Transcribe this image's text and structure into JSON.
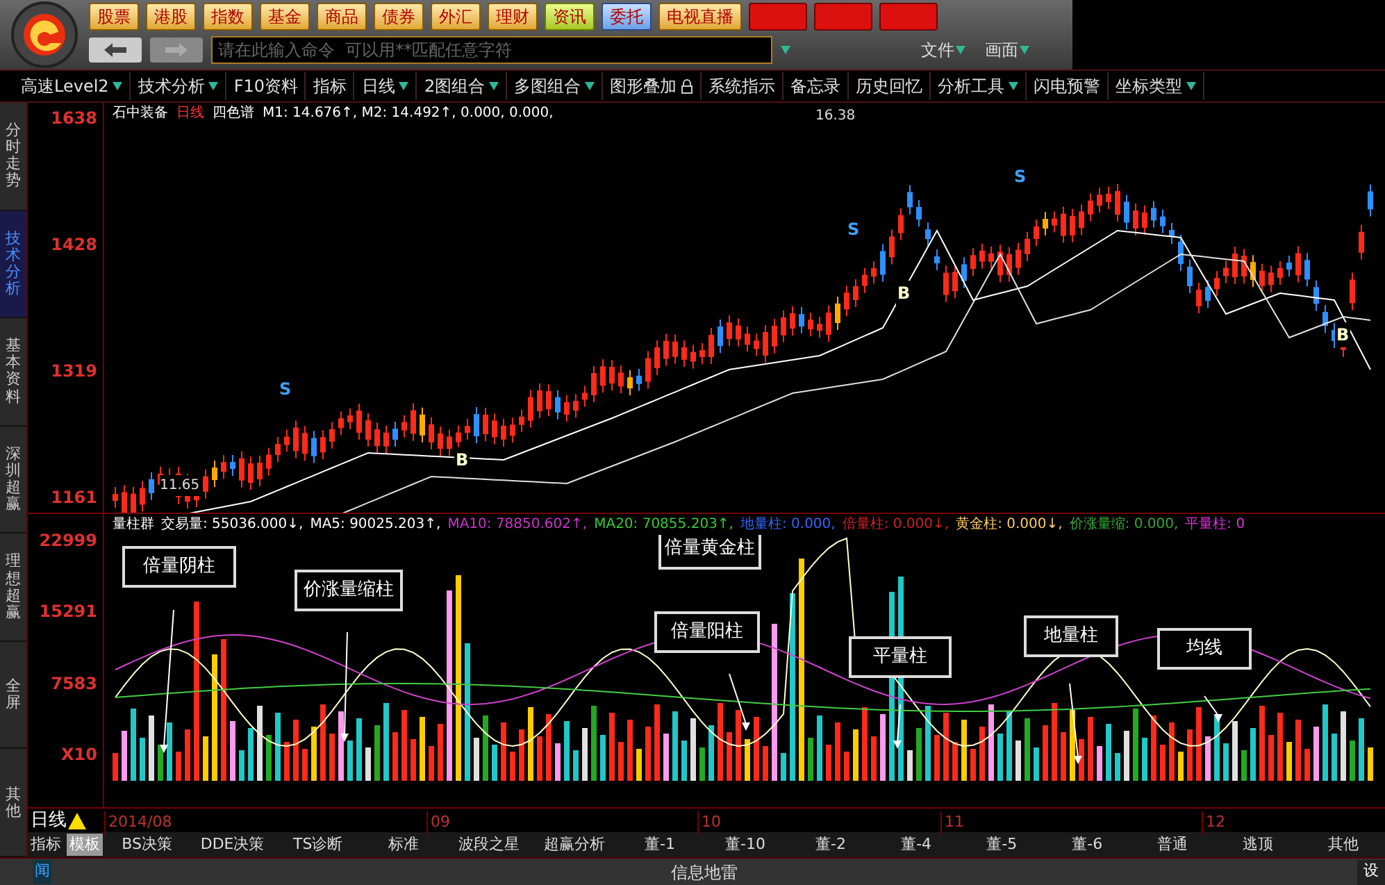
{
  "top_menu": [
    {
      "label": "股票",
      "kind": "gold"
    },
    {
      "label": "港股",
      "kind": "gold"
    },
    {
      "label": "指数",
      "kind": "gold"
    },
    {
      "label": "基金",
      "kind": "gold"
    },
    {
      "label": "商品",
      "kind": "gold"
    },
    {
      "label": "债券",
      "kind": "gold"
    },
    {
      "label": "外汇",
      "kind": "gold"
    },
    {
      "label": "理财",
      "kind": "gold"
    },
    {
      "label": "资讯",
      "kind": "lime"
    },
    {
      "label": "委托",
      "kind": "blue"
    },
    {
      "label": "电视直播",
      "kind": "gold"
    }
  ],
  "command_input": {
    "placeholder": "请在此输入命令  可以用**匹配任意字符"
  },
  "window_menu": [
    {
      "label": "文件"
    },
    {
      "label": "画面"
    }
  ],
  "toolbar": [
    {
      "label": "高速Level2",
      "dropdown": true,
      "lock": false
    },
    {
      "label": "技术分析",
      "dropdown": true,
      "lock": false
    },
    {
      "label": "F10资料",
      "dropdown": false,
      "lock": false
    },
    {
      "label": "指标",
      "dropdown": false,
      "lock": false
    },
    {
      "label": "日线",
      "dropdown": true,
      "lock": false
    },
    {
      "label": "2图组合",
      "dropdown": true,
      "lock": false
    },
    {
      "label": "多图组合",
      "dropdown": true,
      "lock": false
    },
    {
      "label": "图形叠加",
      "dropdown": false,
      "lock": true
    },
    {
      "label": "系统指示",
      "dropdown": false,
      "lock": false
    },
    {
      "label": "备忘录",
      "dropdown": false,
      "lock": false
    },
    {
      "label": "历史回忆",
      "dropdown": false,
      "lock": false
    },
    {
      "label": "分析工具",
      "dropdown": true,
      "lock": false
    },
    {
      "label": "闪电预警",
      "dropdown": false,
      "lock": false
    },
    {
      "label": "坐标类型",
      "dropdown": true,
      "lock": false
    }
  ],
  "side_tabs": [
    {
      "label": "分时走势",
      "selected": false
    },
    {
      "label": "技术分析",
      "selected": true
    },
    {
      "label": "基本资料",
      "selected": false
    },
    {
      "label": "深圳超赢",
      "selected": false
    },
    {
      "label": "理想超赢",
      "selected": false
    },
    {
      "label": "全屏",
      "selected": false
    },
    {
      "label": "其他",
      "selected": false
    }
  ],
  "price_header": [
    {
      "text": "石中装备",
      "color": "#ffffff"
    },
    {
      "text": "日线",
      "color": "#ff3333"
    },
    {
      "text": "四色谱",
      "color": "#ffffff"
    },
    {
      "text": "M1: 14.676↑, M2: 14.492↑, 0.000, 0.000,",
      "color": "#ffffff"
    }
  ],
  "price_axis": [
    "1638",
    "1428",
    "1319",
    "1161"
  ],
  "price_labels": [
    {
      "text": "16.38"
    },
    {
      "text": "11.65"
    }
  ],
  "signals": [
    {
      "text": "S"
    },
    {
      "text": "B"
    },
    {
      "text": "S"
    },
    {
      "text": "B"
    },
    {
      "text": "S"
    },
    {
      "text": "B"
    }
  ],
  "volume_header": [
    {
      "text": "量柱群",
      "color": "#ffffff"
    },
    {
      "text": "交易量: 55036.000↓,",
      "color": "#ffffff"
    },
    {
      "text": "MA5: 90025.203↑,",
      "color": "#ffffff"
    },
    {
      "text": "MA10: 78850.602↑,",
      "color": "#cc33cc"
    },
    {
      "text": "MA20: 70855.203↑,",
      "color": "#33cc33"
    },
    {
      "text": "地量柱: 0.000,",
      "color": "#3366ff"
    },
    {
      "text": "倍量柱: 0.000↓,",
      "color": "#cc2222"
    },
    {
      "text": "黄金柱: 0.000↓,",
      "color": "#ffcc66"
    },
    {
      "text": "价涨量缩: 0.000,",
      "color": "#33aa33"
    },
    {
      "text": "平量柱: 0",
      "color": "#dd33dd"
    }
  ],
  "volume_axis": [
    "22999",
    "15291",
    "7583",
    "X10"
  ],
  "callouts": [
    {
      "text": "倍量阴柱"
    },
    {
      "text": "价涨量缩柱"
    },
    {
      "text": "倍量黄金柱"
    },
    {
      "text": "倍量阳柱"
    },
    {
      "text": "平量柱"
    },
    {
      "text": "地量柱"
    },
    {
      "text": "均线"
    }
  ],
  "period": {
    "label": "日线"
  },
  "date_axis": [
    "2014/08",
    "09",
    "10",
    "11",
    "12"
  ],
  "bottom_tabs": [
    {
      "label": "指标",
      "selected": false
    },
    {
      "label": "模板",
      "selected": true
    },
    {
      "label": "BS决策",
      "selected": false
    },
    {
      "label": "DDE决策",
      "selected": false
    },
    {
      "label": "TS诊断",
      "selected": false
    },
    {
      "label": "标准",
      "selected": false
    },
    {
      "label": "波段之星",
      "selected": false
    },
    {
      "label": "超赢分析",
      "selected": false
    },
    {
      "label": "董-1",
      "selected": false
    },
    {
      "label": "董-10",
      "selected": false
    },
    {
      "label": "董-2",
      "selected": false
    },
    {
      "label": "董-4",
      "selected": false
    },
    {
      "label": "董-5",
      "selected": false
    },
    {
      "label": "董-6",
      "selected": false
    },
    {
      "label": "普通",
      "selected": false
    },
    {
      "label": "逃顶",
      "selected": false
    },
    {
      "label": "其他",
      "selected": false
    }
  ],
  "status_bar": {
    "left": "闻",
    "center": "信息地雷",
    "right": "设"
  }
}
